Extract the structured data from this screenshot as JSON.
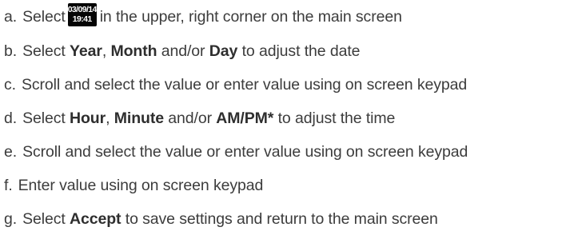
{
  "steps": [
    {
      "marker": "a.",
      "parts": [
        {
          "t": "text",
          "v": "Select"
        },
        {
          "t": "badge",
          "date": "03/09/14",
          "time": "19:41"
        },
        {
          "t": "text",
          "v": "in the upper, right corner on the main screen"
        }
      ]
    },
    {
      "marker": "b.",
      "parts": [
        {
          "t": "text",
          "v": "Select "
        },
        {
          "t": "bold",
          "v": "Year"
        },
        {
          "t": "text",
          "v": ", "
        },
        {
          "t": "bold",
          "v": "Month"
        },
        {
          "t": "text",
          "v": " and/or "
        },
        {
          "t": "bold",
          "v": "Day"
        },
        {
          "t": "text",
          "v": " to adjust the date"
        }
      ]
    },
    {
      "marker": "c.",
      "parts": [
        {
          "t": "text",
          "v": "Scroll and select the value or enter value using on screen keypad"
        }
      ]
    },
    {
      "marker": "d.",
      "parts": [
        {
          "t": "text",
          "v": "Select "
        },
        {
          "t": "bold",
          "v": "Hour"
        },
        {
          "t": "text",
          "v": ", "
        },
        {
          "t": "bold",
          "v": "Minute"
        },
        {
          "t": "text",
          "v": " and/or "
        },
        {
          "t": "bold",
          "v": "AM/PM*"
        },
        {
          "t": "text",
          "v": " to adjust the time"
        }
      ]
    },
    {
      "marker": "e.",
      "parts": [
        {
          "t": "text",
          "v": "Scroll and select the value or enter value using on screen keypad"
        }
      ]
    },
    {
      "marker": "f.",
      "parts": [
        {
          "t": "text",
          "v": "Enter value using on screen keypad"
        }
      ]
    },
    {
      "marker": "g.",
      "parts": [
        {
          "t": "text",
          "v": "Select "
        },
        {
          "t": "bold",
          "v": "Accept"
        },
        {
          "t": "text",
          "v": " to save settings and return to the main screen"
        }
      ]
    }
  ]
}
